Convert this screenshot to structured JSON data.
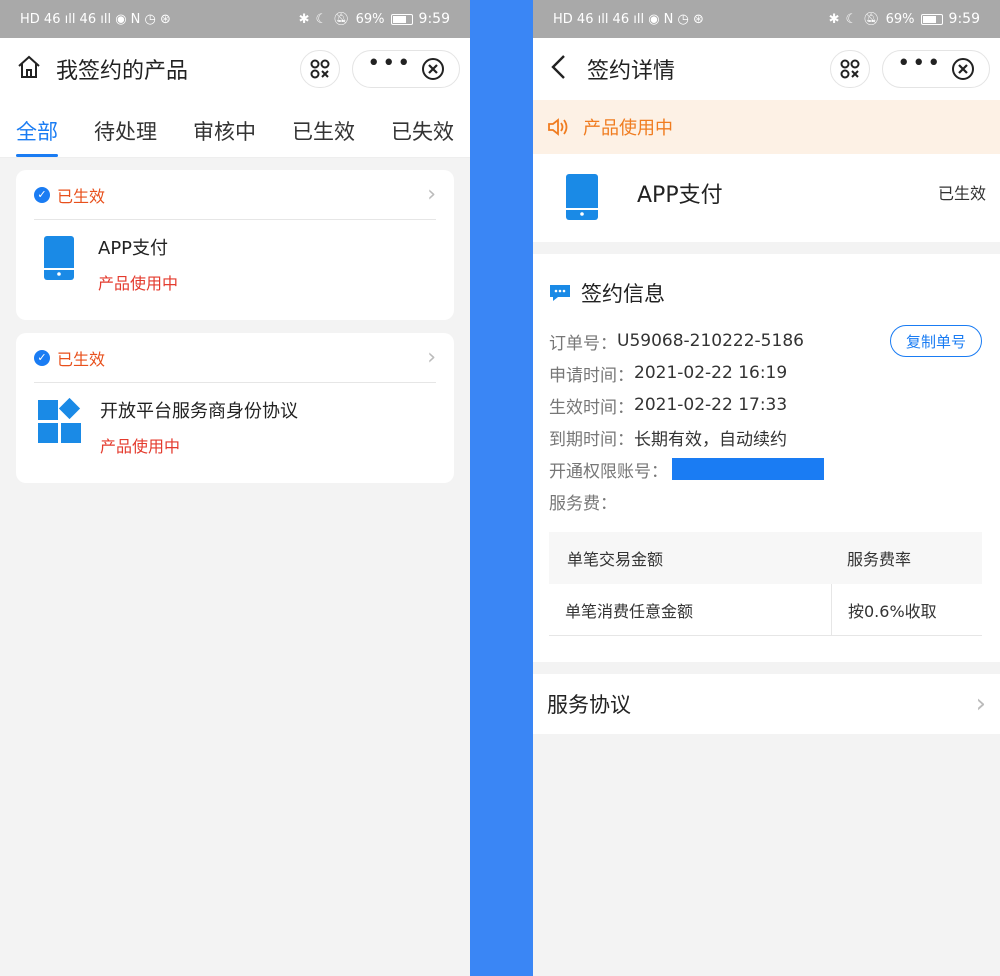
{
  "status_bar": {
    "battery": "69%",
    "time": "9:59",
    "left_icons": "HD 46 ıll 46 ıll ◉ N ◷ ⊛"
  },
  "left": {
    "title": "我签约的产品",
    "tabs": [
      "全部",
      "待处理",
      "审核中",
      "已生效",
      "已失效"
    ],
    "active_tab": "全部",
    "cards": [
      {
        "status": "已生效",
        "name": "APP支付",
        "usage": "产品使用中"
      },
      {
        "status": "已生效",
        "name": "开放平台服务商身份协议",
        "usage": "产品使用中"
      }
    ]
  },
  "right": {
    "title": "签约详情",
    "notice": "产品使用中",
    "product": {
      "name": "APP支付",
      "status": "已生效"
    },
    "section_title": "签约信息",
    "info": {
      "order_label": "订单号：",
      "order_value": "U59068-210222-5186",
      "copy_button": "复制单号",
      "apply_label": "申请时间：",
      "apply_value": "2021-02-22 16:19",
      "effective_label": "生效时间：",
      "effective_value": "2021-02-22 17:33",
      "expire_label": "到期时间：",
      "expire_value": "长期有效，自动续约",
      "account_label": "开通权限账号：",
      "fee_label": "服务费："
    },
    "fee_table": {
      "headers": [
        "单笔交易金额",
        "服务费率"
      ],
      "rows": [
        [
          "单笔消费任意金额",
          "按0.6%收取"
        ]
      ]
    },
    "agreement": "服务协议"
  },
  "colors": {
    "accent": "#1a7cf3",
    "orange": "#e8501c",
    "red": "#e43b2e",
    "divider": "#3a86f5"
  }
}
